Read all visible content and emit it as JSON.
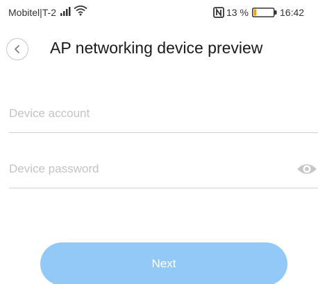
{
  "status_bar": {
    "carrier": "Mobitel|T-2",
    "battery_percent": "13 %",
    "battery_level": 0.13,
    "time": "16:42",
    "icons": [
      "signal-icon",
      "wifi-icon",
      "nfc-icon",
      "battery-icon"
    ]
  },
  "header": {
    "title": "AP networking device preview",
    "back_icon": "chevron-left-icon"
  },
  "form": {
    "account_placeholder": "Device account",
    "account_value": "",
    "password_placeholder": "Device password",
    "password_value": "",
    "password_toggle_icon": "eye-icon"
  },
  "actions": {
    "next_label": "Next"
  },
  "colors": {
    "accent": "#93c9f7",
    "placeholder": "#c3c3c3",
    "divider": "#cfcfcf",
    "battery_low": "#f39c12"
  }
}
